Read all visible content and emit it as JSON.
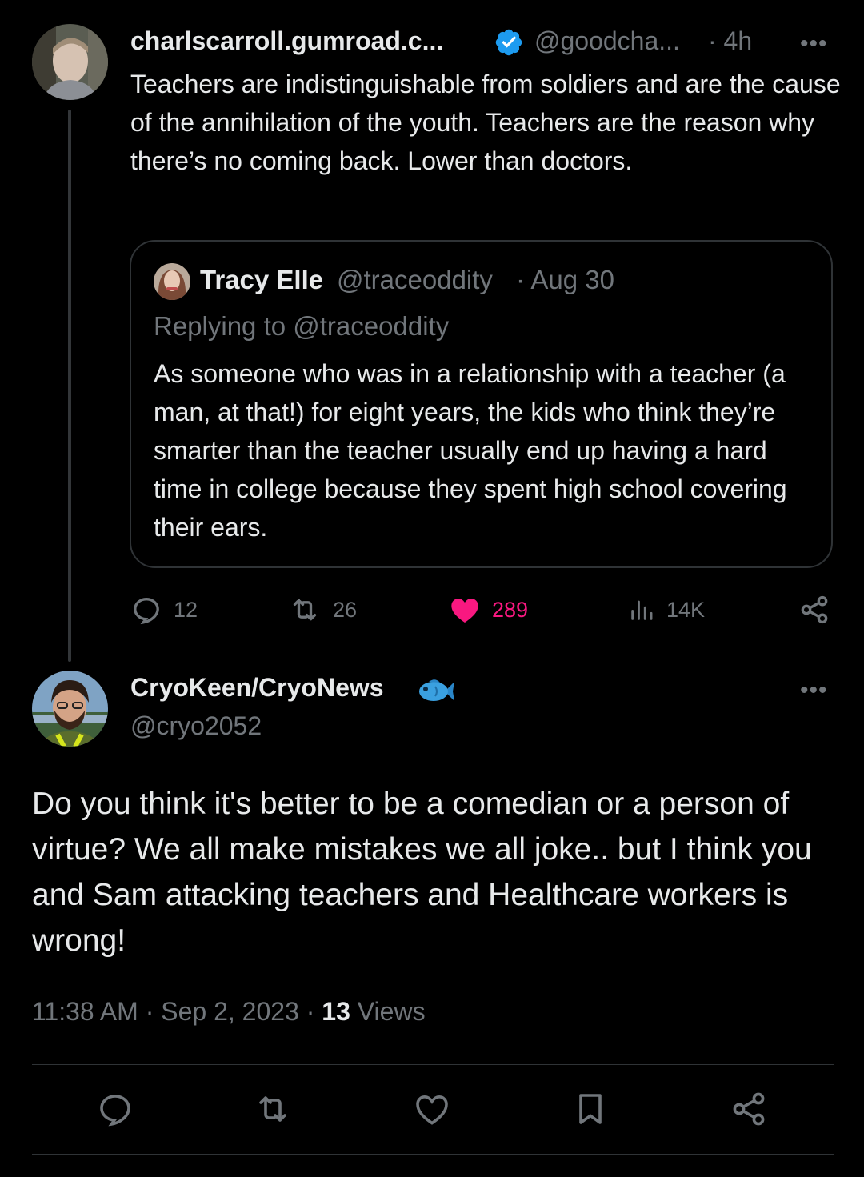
{
  "parent_tweet": {
    "display_name": "charlscarroll.gumroad.c...",
    "handle": "@goodcha...",
    "time": "· 4h",
    "more": "•••",
    "text": "Teachers are indistinguishable from soldiers and are the cause of the annihilation of the youth. Teachers are the reason why there’s no coming back. Lower than doctors.",
    "quote": {
      "display_name": "Tracy Elle",
      "handle": "@traceoddity",
      "date": "· Aug 30",
      "replying_to": "Replying to @traceoddity",
      "text": "As someone who was in a relationship with a teacher (a man, at that!) for eight years, the kids who think they’re smarter than the teacher usually end up having a hard time in college because they spent high school covering their ears."
    },
    "stats": {
      "replies": "12",
      "retweets": "26",
      "likes": "289",
      "views": "14K"
    }
  },
  "main_tweet": {
    "display_name": "CryoKeen/CryoNews",
    "handle": "@cryo2052",
    "more": "•••",
    "text": "Do you think it's better to be a comedian or a person of virtue? We all make mistakes we all joke.. but I think you and Sam attacking teachers and Healthcare workers is wrong!",
    "timestamp": "11:38 AM · Sep 2, 2023 ·",
    "views_count": "13",
    "views_label": "Views"
  },
  "colors": {
    "background": "#000000",
    "text": "#e7e9ea",
    "muted": "#71767b",
    "like": "#f91880",
    "verified": "#1d9bf0",
    "border": "#2f3336"
  },
  "icons": {
    "verified": "verified-badge-icon",
    "fish": "fish-emoji-icon",
    "reply": "reply-icon",
    "retweet": "retweet-icon",
    "like": "heart-icon",
    "views": "views-chart-icon",
    "share": "share-icon",
    "bookmark": "bookmark-icon"
  }
}
